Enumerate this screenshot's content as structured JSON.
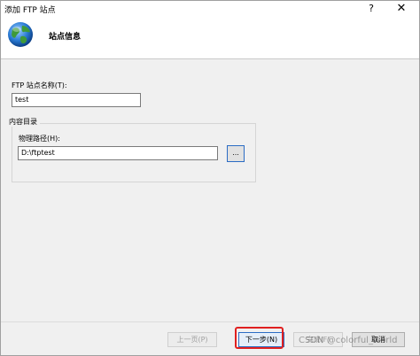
{
  "window": {
    "title": "添加 FTP 站点",
    "help_label": "?",
    "close_label": "✕"
  },
  "header": {
    "title": "站点信息",
    "icon": "globe-icon"
  },
  "site_name": {
    "label": "FTP 站点名称(T):",
    "value": "test"
  },
  "content_directory": {
    "group_label": "内容目录",
    "physical_path_label": "物理路径(H):",
    "physical_path_value": "D:\\ftptest",
    "browse_label": "..."
  },
  "buttons": {
    "previous": "上一页(P)",
    "next": "下一步(N)",
    "finish": "完成(F)",
    "cancel": "取消"
  },
  "watermark": "CSDN @colorful_world",
  "colors": {
    "highlight": "#e02020",
    "focus_border": "#2b6cc4"
  }
}
